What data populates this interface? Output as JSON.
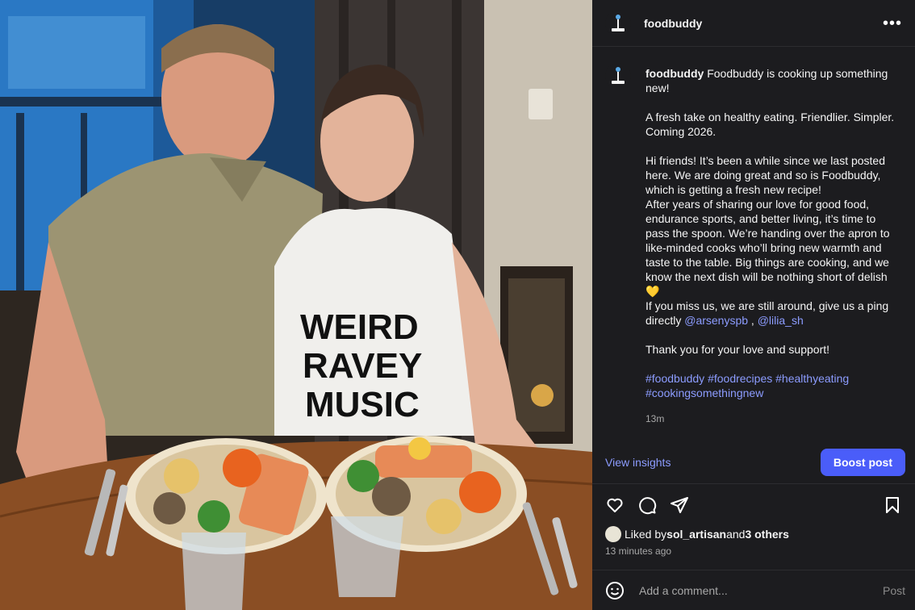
{
  "header": {
    "username": "foodbuddy",
    "more_label": "•••"
  },
  "caption": {
    "username": "foodbuddy",
    "intro": " Foodbuddy is cooking up something new!",
    "para1": "A fresh take on healthy eating. Friendlier. Simpler. Coming 2026.",
    "para2": "Hi friends! It’s been a while since we last posted here. We are doing great and so is Foodbuddy, which is getting a fresh new recipe!\nAfter years of sharing our love for good food, endurance sports, and better living, it’s time to pass the spoon. We’re handing over the apron to like-minded cooks who’ll bring new warmth and taste to the table. Big things are cooking, and we know the next dish will be nothing short of delish 💛\nIf you miss us, we are still around, give us a ping directly ",
    "mention1": "@arsenyspb",
    "mention_sep": " , ",
    "mention2": "@lilia_sh",
    "thanks": "Thank you for your love and support!",
    "hashtags": [
      "#foodbuddy",
      "#foodrecipes",
      "#healthyeating",
      "#cookingsomethingnew"
    ],
    "time": "13m"
  },
  "insights": {
    "view_label": "View insights",
    "boost_label": "Boost post"
  },
  "likes": {
    "prefix": "Liked by ",
    "user": "sol_artisan",
    "middle": " and ",
    "others": "3 others",
    "ago": "13 minutes ago"
  },
  "comment": {
    "placeholder": "Add a comment...",
    "post_label": "Post"
  },
  "photo": {
    "shirt_text": [
      "WEIRD",
      "RAVEY",
      "MUSIC"
    ]
  },
  "colors": {
    "accent": "#4a5df9",
    "link": "#8c9cff",
    "panel": "#1c1c1f"
  }
}
